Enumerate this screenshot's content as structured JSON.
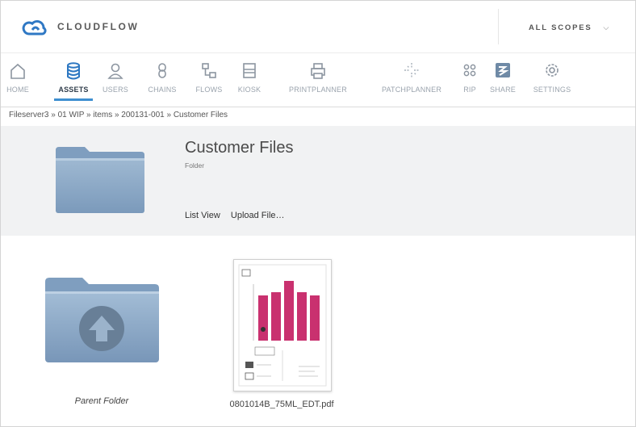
{
  "app": {
    "brand": "CLOUDFLOW",
    "scope_label": "ALL SCOPES"
  },
  "nav": {
    "items": [
      {
        "label": "HOME",
        "icon": "home-icon"
      },
      {
        "label": "ASSETS",
        "icon": "database-icon",
        "active": true
      },
      {
        "label": "USERS",
        "icon": "user-icon"
      },
      {
        "label": "CHAINS",
        "icon": "chain-icon"
      },
      {
        "label": "FLOWS",
        "icon": "flows-icon"
      },
      {
        "label": "KIOSK",
        "icon": "kiosk-icon"
      },
      {
        "label": "PRINTPLANNER",
        "icon": "printer-icon"
      },
      {
        "label": "PATCHPLANNER",
        "icon": "patchplanner-icon"
      },
      {
        "label": "RIP",
        "icon": "rip-icon"
      },
      {
        "label": "SHARE",
        "icon": "share-icon"
      },
      {
        "label": "SETTINGS",
        "icon": "gear-icon"
      }
    ]
  },
  "breadcrumb": "Fileserver3 » 01 WIP » items » 200131-001 » Customer Files",
  "folder": {
    "title": "Customer Files",
    "type": "Folder",
    "actions": [
      "List View",
      "Upload File…"
    ]
  },
  "items": [
    {
      "name": "Parent Folder",
      "kind": "parent-folder"
    },
    {
      "name": "0801014B_75ML_EDT.pdf",
      "kind": "pdf"
    }
  ],
  "colors": {
    "accent": "#3e8fd0",
    "folder": "#8aa9c6",
    "thumb_bars": "#c9316f",
    "header_bg": "#f1f2f3"
  }
}
